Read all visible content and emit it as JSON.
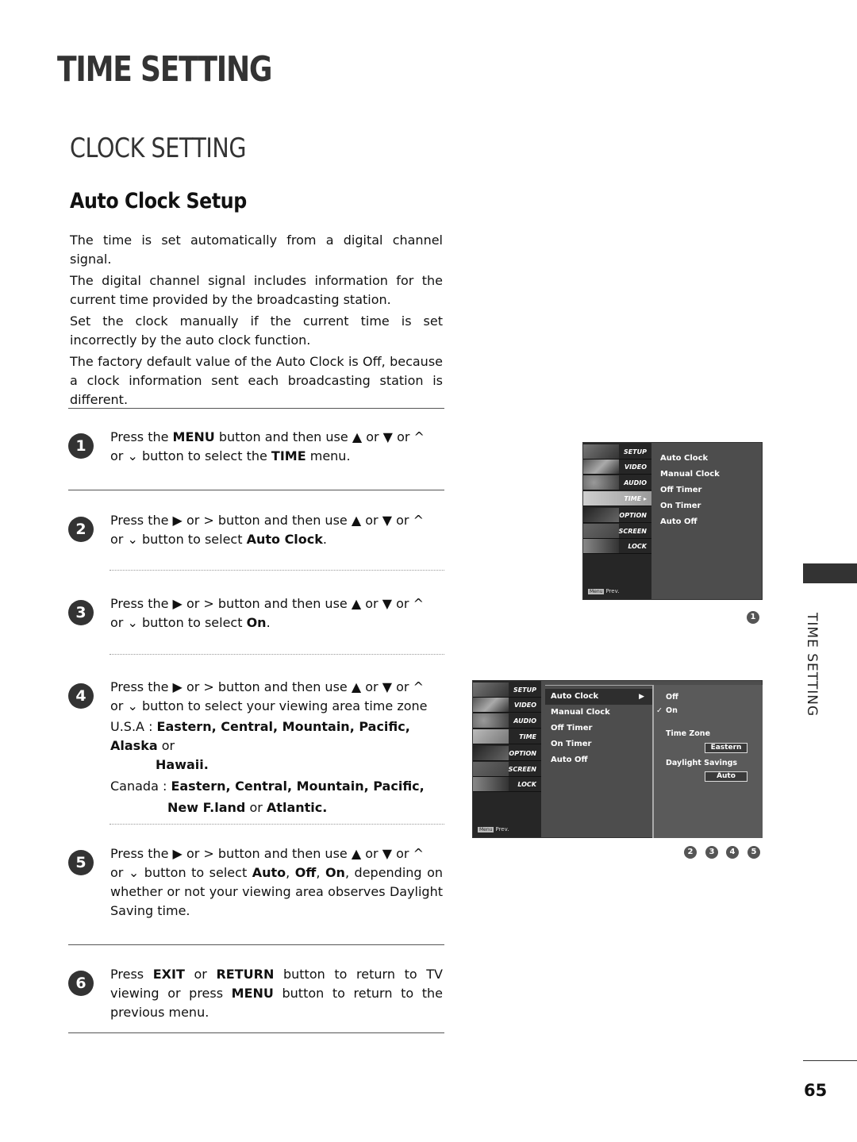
{
  "header": {
    "title": "TIME SETTING",
    "section": "CLOCK SETTING",
    "subsection": "Auto Clock Setup"
  },
  "intro": [
    "The time is set automatically from a digital channel signal.",
    "The digital channel signal includes information for the current time provided by the broadcasting station.",
    "Set the clock manually if the current time is set incorrectly by the auto clock function.",
    "The factory default value of the Auto Clock is Off, because a clock information sent each broadcasting station is different."
  ],
  "glyphs": {
    "up_solid": "▲",
    "down_solid": "▼",
    "up_caret": "^",
    "down_caret": "⌄",
    "right_solid": "▶",
    "right_caret": ">"
  },
  "steps": [
    {
      "number": "1",
      "pre": "Press the ",
      "menu": "MENU",
      "mid": " button and then use ",
      "or": " or ",
      "tail": " button to select the ",
      "target": "TIME",
      "end": " menu."
    },
    {
      "number": "2",
      "pre": "Press the ",
      "mid": " button and then use ",
      "or": " or ",
      "tail": " button to select ",
      "target": "Auto Clock",
      "end": "."
    },
    {
      "number": "3",
      "pre": "Press the ",
      "mid": " button and then use ",
      "or": " or ",
      "tail": " button to select ",
      "target": "On",
      "end": "."
    },
    {
      "number": "4",
      "pre": "Press the ",
      "mid": " button and then use ",
      "or": " or ",
      "tail": " button to select your viewing area time zone",
      "usa_label": "U.S.A : ",
      "usa_zones": "Eastern, Central, Mountain, Pacific, Alaska",
      "usa_last": "Hawaii.",
      "canada_label": "Canada : ",
      "canada_zones": "Eastern, Central, Mountain, Pacific,",
      "canada_zone_a": "New F.land",
      "canada_zone_b": "Atlantic."
    },
    {
      "number": "5",
      "pre": "Press the ",
      "mid": " button and then use ",
      "or": " or ",
      "tail": " button to select ",
      "opt_auto": "Auto",
      "opt_off": "Off",
      "opt_on": "On",
      "end": ", depending on whether or not your viewing area observes Daylight Saving time."
    },
    {
      "number": "6",
      "pre": "Press ",
      "exit": "EXIT",
      "or": " or ",
      "return": "RETURN",
      "mid": " button to return to TV viewing or press ",
      "menu": "MENU",
      "end": " button to return to the previous menu."
    }
  ],
  "tv_sidebar": [
    "SETUP",
    "VIDEO",
    "AUDIO",
    "TIME",
    "OPTION",
    "SCREEN",
    "LOCK"
  ],
  "tv_prev": {
    "key": "Menu",
    "label": "Prev."
  },
  "tv_screen1": {
    "selected_sidebar": "TIME",
    "menu_items": [
      "Auto Clock",
      "Manual Clock",
      "Off Timer",
      "On Timer",
      "Auto Off"
    ],
    "caption_steps": [
      "1"
    ]
  },
  "tv_screen2": {
    "menu_items": [
      "Auto Clock",
      "Manual Clock",
      "Off Timer",
      "On Timer",
      "Auto Off"
    ],
    "highlighted": "Auto Clock",
    "arrow": "▶",
    "options": [
      "Off",
      "On"
    ],
    "checked": "On",
    "check_mark": "✓",
    "time_zone_label": "Time Zone",
    "time_zone_value": "Eastern",
    "daylight_label": "Daylight Savings",
    "daylight_value": "Auto",
    "caption_steps": [
      "2",
      "3",
      "4",
      "5"
    ]
  },
  "side_tab": "TIME SETTING",
  "page_number": "65"
}
